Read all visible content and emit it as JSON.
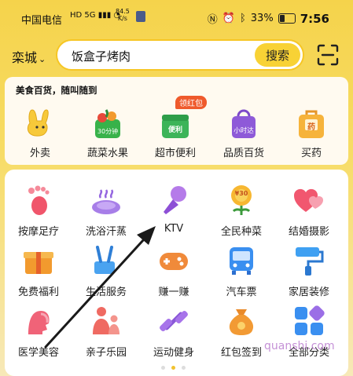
{
  "status": {
    "carrier": "中国电信",
    "signal": "HD 5G ▮▮▮ ◔",
    "speed_value": "84.5",
    "speed_unit": "K/s",
    "battery": "33%",
    "time": "7:56"
  },
  "search": {
    "city": "栾城",
    "query": "饭盒子烤肉",
    "button": "搜索"
  },
  "card1": {
    "title": "美食百货，随叫随到",
    "items": [
      {
        "label": "外卖"
      },
      {
        "label": "蔬菜水果",
        "badge": "30分钟"
      },
      {
        "label": "超市便利",
        "badge": "便利",
        "tag": "领红包"
      },
      {
        "label": "品质百货",
        "badge": "小时达"
      },
      {
        "label": "买药",
        "badge": "药"
      }
    ]
  },
  "grid": [
    {
      "label": "按摩足疗"
    },
    {
      "label": "洗浴汗蒸"
    },
    {
      "label": "KTV"
    },
    {
      "label": "全民种菜",
      "badge": "¥30"
    },
    {
      "label": "结婚摄影"
    },
    {
      "label": "免费福利"
    },
    {
      "label": "生活服务"
    },
    {
      "label": "赚一赚"
    },
    {
      "label": "汽车票"
    },
    {
      "label": "家居装修"
    },
    {
      "label": "医学美容"
    },
    {
      "label": "亲子乐园"
    },
    {
      "label": "运动健身"
    },
    {
      "label": "红包签到"
    },
    {
      "label": "全部分类"
    }
  ],
  "watermark": "quanshi.com"
}
